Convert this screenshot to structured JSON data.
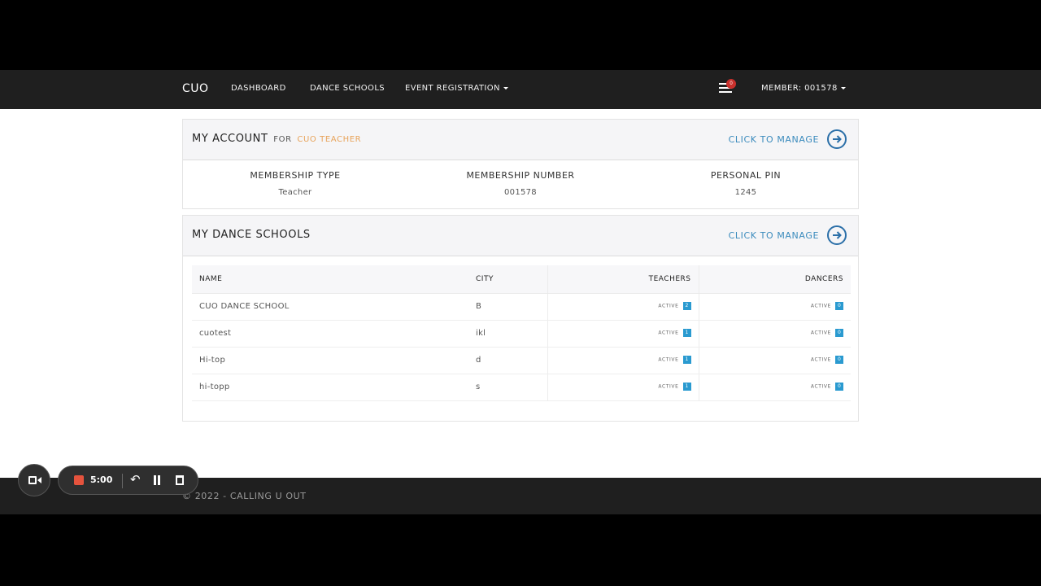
{
  "navbar": {
    "brand": "CUO",
    "links": [
      "DASHBOARD",
      "DANCE SCHOOLS",
      "EVENT REGISTRATION"
    ],
    "notification_count": "0",
    "member_label": "MEMBER: 001578"
  },
  "account": {
    "title": "MY ACCOUNT",
    "for_label": "FOR",
    "for_who": "CUO TEACHER",
    "manage_label": "CLICK TO MANAGE",
    "fields": [
      {
        "label": "MEMBERSHIP TYPE",
        "value": "Teacher"
      },
      {
        "label": "MEMBERSHIP NUMBER",
        "value": "001578"
      },
      {
        "label": "PERSONAL PIN",
        "value": "1245"
      }
    ]
  },
  "schools": {
    "title": "MY DANCE SCHOOLS",
    "manage_label": "CLICK TO MANAGE",
    "columns": [
      "NAME",
      "CITY",
      "TEACHERS",
      "DANCERS"
    ],
    "active_label": "ACTIVE",
    "rows": [
      {
        "name": "CUO DANCE SCHOOL",
        "city": "B",
        "teachers": "2",
        "dancers": "0"
      },
      {
        "name": "cuotest",
        "city": "ikl",
        "teachers": "1",
        "dancers": "0"
      },
      {
        "name": "Hi-top",
        "city": "d",
        "teachers": "1",
        "dancers": "0"
      },
      {
        "name": "hi-topp",
        "city": "s",
        "teachers": "1",
        "dancers": "0"
      }
    ]
  },
  "footer": {
    "text": "© 2022 - CALLING U OUT"
  },
  "recorder": {
    "time": "5:00",
    "undo_glyph": "↶"
  },
  "colors": {
    "nav_bg": "#1f1f1f",
    "accent": "#3b8bbd",
    "for_who": "#e8a35a",
    "badge": "#2a9ad0",
    "rec_stop": "#e5533d"
  }
}
